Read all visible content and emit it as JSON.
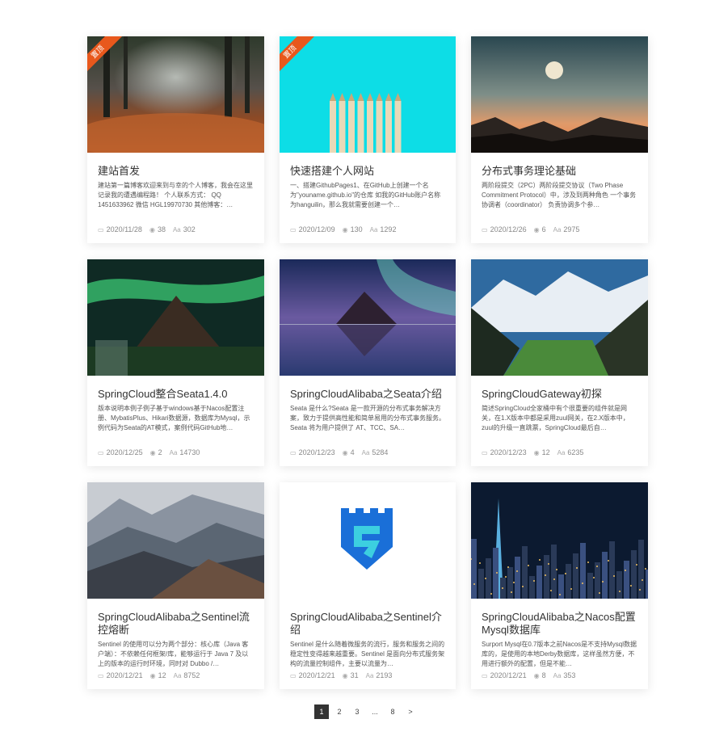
{
  "posts": [
    {
      "title": "建站首发",
      "excerpt": "建站第一篇博客欢迎来到与幸的个人博客，我会在这里记录我的遭遇编程路！ 个人联系方式： QQ 1451633962 微信 HGL19970730 其他博客：…",
      "date": "2020/11/28",
      "views": "38",
      "words": "302",
      "pinned": true,
      "pinned_label": "置顶",
      "image": "autumn-path"
    },
    {
      "title": "快速搭建个人网站",
      "excerpt": "一、搭建GithubPages1、在GitHub上创建一个名为\"youname.github.io\"的仓库 如我的GitHub账户名称为hanguilin，那么我就需要创建一个…",
      "date": "2020/12/09",
      "views": "130",
      "words": "1292",
      "pinned": true,
      "pinned_label": "置顶",
      "image": "pencils"
    },
    {
      "title": "分布式事务理论基础",
      "excerpt": "两阶段提交（2PC）两阶段提交协议（Two Phase Commitment Protocol）中，涉及到两种角色 一个事务协调者（coordinator） 负责协调多个参…",
      "date": "2020/12/26",
      "views": "6",
      "words": "2975",
      "pinned": false,
      "image": "moon-sunset"
    },
    {
      "title": "SpringCloud整合Seata1.4.0",
      "excerpt": "版本说明本例子例子基于windows基于Nacos配置注册、MybatisPlus、Hikari数据源，数据库为Mysql，示例代码为Seata的AT模式，案例代码GitHub地…",
      "date": "2020/12/25",
      "views": "2",
      "words": "14730",
      "pinned": false,
      "image": "aurora-green"
    },
    {
      "title": "SpringCloudAlibaba之Seata介绍",
      "excerpt": "Seata 是什么?Seata 是一款开源的分布式事务解决方案，致力于提供高性能和简单易用的分布式事务服务。Seata 将为用户提供了 AT、TCC、SA…",
      "date": "2020/12/23",
      "views": "4",
      "words": "5284",
      "pinned": false,
      "image": "aurora-lake"
    },
    {
      "title": "SpringCloudGateway初探",
      "excerpt": "简述SpringCloud全家桶中有个很重要的组件就是网关，在1.X版本中都是采用zuul网关，在2.X版本中，zuul的升级一直跳票，SpringCloud最后自…",
      "date": "2020/12/23",
      "views": "12",
      "words": "6235",
      "pinned": false,
      "image": "valley"
    },
    {
      "title": "SpringCloudAlibaba之Sentinel流控熔断",
      "excerpt": "Sentinel 的使用可以分为两个部分：核心库（Java 客户端）：不依赖任何框架/库，能够运行于 Java 7 及以上的版本的运行时环境，同时对 Dubbo /…",
      "date": "2020/12/21",
      "views": "12",
      "words": "8752",
      "pinned": false,
      "image": "mountains"
    },
    {
      "title": "SpringCloudAlibaba之Sentinel介绍",
      "excerpt": "Sentinel 是什么随着微服务的流行，服务和服务之间的稳定性变得越来越重要。Sentinel 是面向分布式服务架构的流量控制组件，主要以流量为…",
      "date": "2020/12/21",
      "views": "31",
      "words": "2193",
      "pinned": false,
      "image": "sentinel-logo"
    },
    {
      "title": "SpringCloudAlibaba之Nacos配置Mysql数据库",
      "excerpt": "Surport Mysql在0.7版本之前Nacos是不支持Mysql数据库的，是使用的本地Derby数据库，这样虽然方便，不用进行额外的配置，但是不能…",
      "date": "2020/12/21",
      "views": "8",
      "words": "353",
      "pinned": false,
      "image": "city-night"
    }
  ],
  "icons": {
    "date": "calendar-icon",
    "views": "eye-icon",
    "words": "words-icon"
  },
  "icon_glyphs": {
    "date": "▭",
    "views": "◉",
    "words": "Aa"
  },
  "pagination": [
    "1",
    "2",
    "3",
    "...",
    "8",
    ">"
  ],
  "pagination_active": "1"
}
